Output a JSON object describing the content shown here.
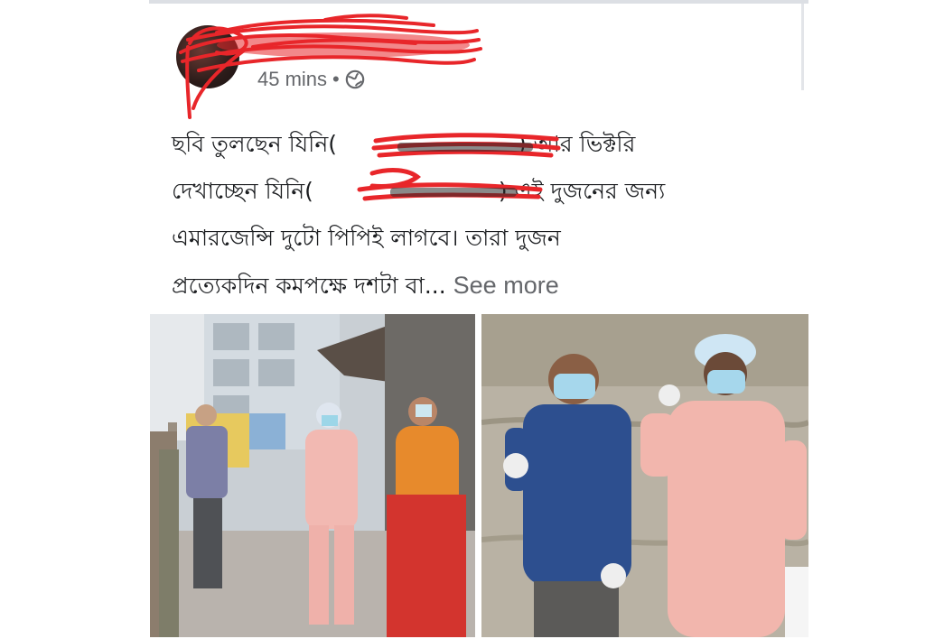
{
  "post": {
    "author_name": "",
    "timestamp": "45 mins",
    "separator": "•",
    "privacy_icon": "globe-icon",
    "text_lines": [
      "ছবি তুলছেন যিনি(",
      ") আর ভিক্টরি",
      "দেখাচ্ছেন যিনি(",
      ") এই দুজনের জন্য",
      "এমারজেন্সি দুটো পিপিই লাগবে। তারা দুজন",
      "প্রত্যেকদিন কমপক্ষে দশটা বা..."
    ],
    "see_more_label": "See more"
  },
  "colors": {
    "scribble_red": "#e8262a",
    "meta_gray": "#65676b",
    "text_dark": "#1c1e21"
  },
  "photos": [
    {
      "name": "street-photo",
      "description_icon": "photo"
    },
    {
      "name": "wall-photo",
      "description_icon": "photo"
    }
  ]
}
